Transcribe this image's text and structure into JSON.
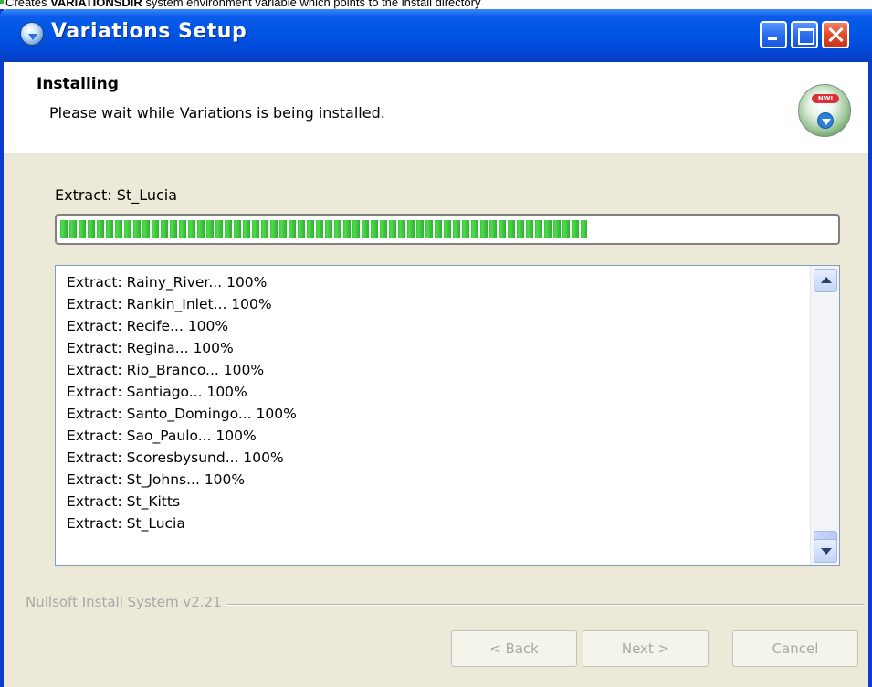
{
  "caption": {
    "prefix": "Creates ",
    "bold": "VARIATIONSDIR",
    "suffix": " system environment variable which points to the install directory"
  },
  "window": {
    "title": "Variations Setup",
    "controls": [
      "minimize",
      "maximize",
      "close"
    ]
  },
  "header": {
    "title": "Installing",
    "subtitle": "Please wait while Variations is being installed.",
    "logo_label": "NWI"
  },
  "install": {
    "status": "Extract: St_Lucia",
    "progress_percent": 68,
    "log": [
      "Extract: Rainy_River... 100%",
      "Extract: Rankin_Inlet... 100%",
      "Extract: Recife... 100%",
      "Extract: Regina... 100%",
      "Extract: Rio_Branco... 100%",
      "Extract: Santiago... 100%",
      "Extract: Santo_Domingo... 100%",
      "Extract: Sao_Paulo... 100%",
      "Extract: Scoresbysund... 100%",
      "Extract: St_Johns... 100%",
      "Extract: St_Kitts",
      "Extract: St_Lucia"
    ]
  },
  "footer": {
    "brand": "Nullsoft Install System v2.21",
    "back_label": "< Back",
    "next_label": "Next >",
    "cancel_label": "Cancel"
  },
  "colors": {
    "titlebar": "#0055e5",
    "progress_green": "#37c53a",
    "dialog_bg": "#ece9d8",
    "disabled_text": "#a8a8a8"
  }
}
